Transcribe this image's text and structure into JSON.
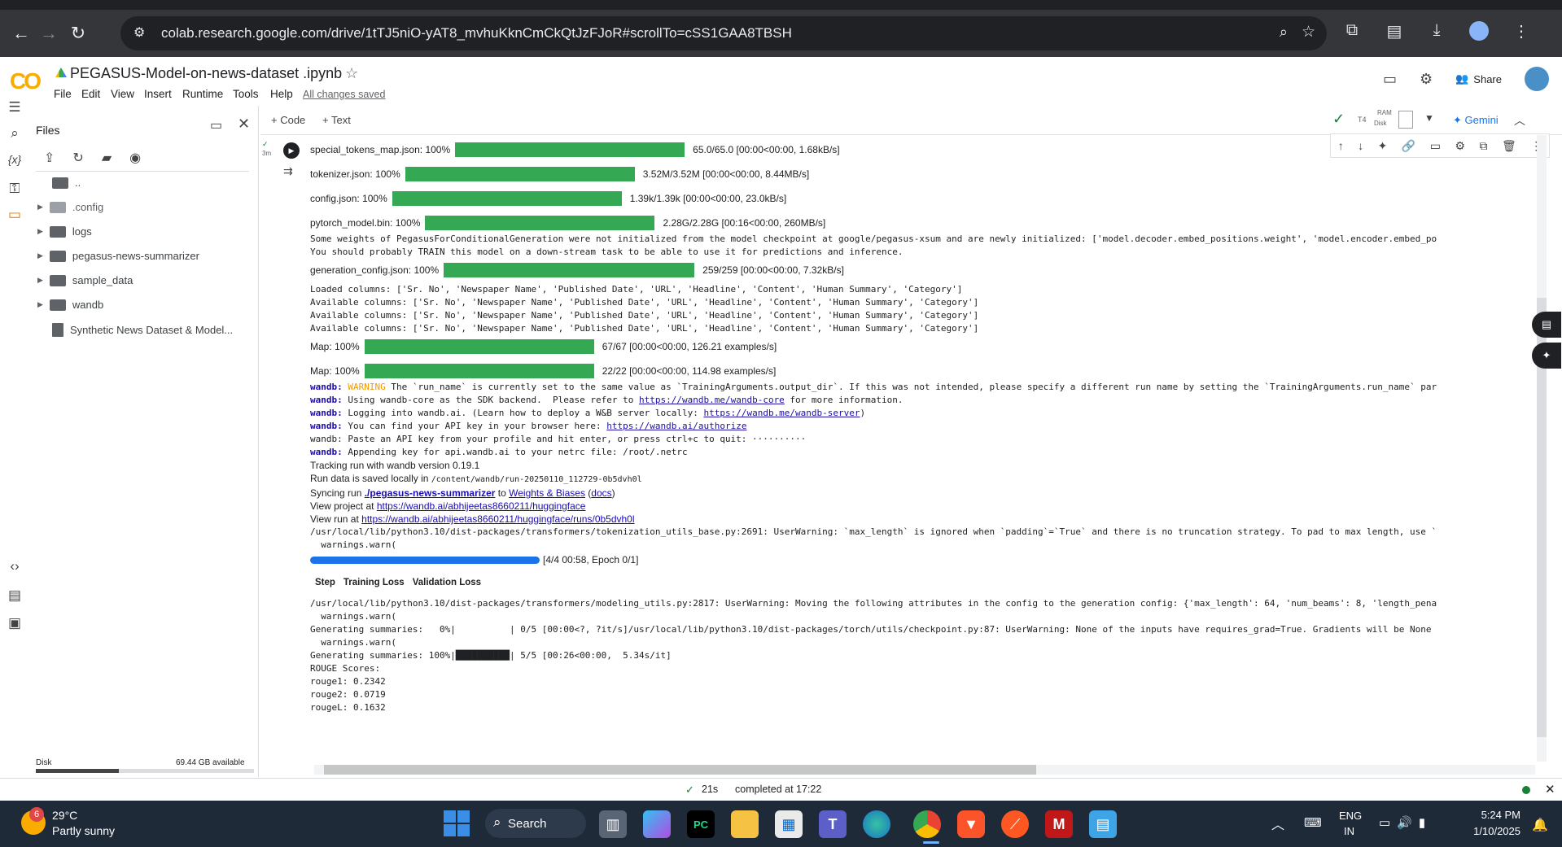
{
  "browser": {
    "url": "colab.research.google.com/drive/1tTJ5niO-yAT8_mvhuKknCmCkQtJzFJoR#scrollTo=cSS1GAA8TBSH"
  },
  "colab": {
    "logo": "CO",
    "notebook_title": "PEGASUS-Model-on-news-dataset .ipynb",
    "menu": [
      "File",
      "Edit",
      "View",
      "Insert",
      "Runtime",
      "Tools",
      "Help"
    ],
    "saved_status": "All changes saved",
    "share_label": "Share",
    "toolbar": {
      "code": "+ Code",
      "text": "+ Text",
      "runtime": "T4",
      "ram": "RAM",
      "disk": "Disk",
      "gemini": "Gemini"
    }
  },
  "files": {
    "title": "Files",
    "items": [
      {
        "name": "..",
        "expandable": false
      },
      {
        "name": ".config",
        "expandable": true
      },
      {
        "name": "logs",
        "expandable": true
      },
      {
        "name": "pegasus-news-summarizer",
        "expandable": true
      },
      {
        "name": "sample_data",
        "expandable": true
      },
      {
        "name": "wandb",
        "expandable": true
      },
      {
        "name": "Synthetic News Dataset & Model...",
        "expandable": false
      }
    ],
    "disk_label": "Disk",
    "disk_available": "69.44 GB available"
  },
  "cell": {
    "exec_time": "3m",
    "progress": [
      {
        "label": "special_tokens_map.json:",
        "pct": "100%",
        "stats": "65.0/65.0 [00:00<00:00, 1.68kB/s]"
      },
      {
        "label": "tokenizer.json:",
        "pct": "100%",
        "stats": "3.52M/3.52M [00:00<00:00, 8.44MB/s]"
      },
      {
        "label": "config.json:",
        "pct": "100%",
        "stats": "1.39k/1.39k [00:00<00:00, 23.0kB/s]"
      },
      {
        "label": "pytorch_model.bin:",
        "pct": "100%",
        "stats": "2.28G/2.28G [00:16<00:00, 260MB/s]"
      }
    ],
    "weights_msg1": "Some weights of PegasusForConditionalGeneration were not initialized from the model checkpoint at google/pegasus-xsum and are newly initialized: ['model.decoder.embed_positions.weight', 'model.encoder.embed_po",
    "weights_msg2": "You should probably TRAIN this model on a down-stream task to be able to use it for predictions and inference.",
    "gen_config": {
      "label": "generation_config.json:",
      "pct": "100%",
      "stats": "259/259 [00:00<00:00, 7.32kB/s]"
    },
    "columns": [
      "Loaded columns: ['Sr. No', 'Newspaper Name', 'Published Date', 'URL', 'Headline', 'Content', 'Human Summary', 'Category']",
      "Available columns: ['Sr. No', 'Newspaper Name', 'Published Date', 'URL', 'Headline', 'Content', 'Human Summary', 'Category']",
      "Available columns: ['Sr. No', 'Newspaper Name', 'Published Date', 'URL', 'Headline', 'Content', 'Human Summary', 'Category']",
      "Available columns: ['Sr. No', 'Newspaper Name', 'Published Date', 'URL', 'Headline', 'Content', 'Human Summary', 'Category']"
    ],
    "maps": [
      {
        "label": "Map:",
        "pct": "100%",
        "stats": "67/67 [00:00<00:00, 126.21 examples/s]"
      },
      {
        "label": "Map:",
        "pct": "100%",
        "stats": "22/22 [00:00<00:00, 114.98 examples/s]"
      }
    ],
    "wandb": {
      "prefix": "wandb:",
      "warning_tag": "WARNING",
      "warning_text": " The `run_name` is currently set to the same value as `TrainingArguments.output_dir`. If this was not intended, please specify a different run name by setting the `TrainingArguments.run_name` par",
      "core_pre": " Using wandb-core as the SDK backend.  Please refer to ",
      "core_link": "https://wandb.me/wandb-core",
      "core_post": " for more information.",
      "login_pre": " Logging into wandb.ai. (Learn how to deploy a W&B server locally: ",
      "login_link": "https://wandb.me/wandb-server",
      "login_post": ")",
      "api_pre": " You can find your API key in your browser here: ",
      "api_link": "https://wandb.ai/authorize",
      "paste": "wandb: Paste an API key from your profile and hit enter, or press ctrl+c to quit: ··········",
      "append": " Appending key for api.wandb.ai to your netrc file: /root/.netrc",
      "tracking": "Tracking run with wandb version 0.19.1",
      "run_saved_pre": "Run data is saved locally in ",
      "run_saved_path": "/content/wandb/run-20250110_112729-0b5dvh0l",
      "sync_pre": "Syncing run ",
      "sync_run": "./pegasus-news-summarizer",
      "sync_mid": " to ",
      "sync_wb": "Weights & Biases",
      "sync_docs_pre": " (",
      "sync_docs": "docs",
      "sync_docs_post": ")",
      "project_pre": "View project at ",
      "project_link": "https://wandb.ai/abhijeetas8660211/huggingface",
      "run_pre": "View run at ",
      "run_link": "https://wandb.ai/abhijeetas8660211/huggingface/runs/0b5dvh0l"
    },
    "tok_warning1": "/usr/local/lib/python3.10/dist-packages/transformers/tokenization_utils_base.py:2691: UserWarning: `max_length` is ignored when `padding`=`True` and there is no truncation strategy. To pad to max length, use `",
    "tok_warning2": "  warnings.warn(",
    "train_progress": {
      "fraction": 1.0,
      "text": "[4/4 00:58, Epoch 0/1]"
    },
    "table_headers": [
      "Step",
      "Training Loss",
      "Validation Loss"
    ],
    "tail_lines": [
      "/usr/local/lib/python3.10/dist-packages/transformers/modeling_utils.py:2817: UserWarning: Moving the following attributes in the config to the generation config: {'max_length': 64, 'num_beams': 8, 'length_pena",
      "  warnings.warn(",
      "Generating summaries:   0%|          | 0/5 [00:00<?, ?it/s]/usr/local/lib/python3.10/dist-packages/torch/utils/checkpoint.py:87: UserWarning: None of the inputs have requires_grad=True. Gradients will be None",
      "  warnings.warn(",
      "Generating summaries: 100%|██████████| 5/5 [00:26<00:00,  5.34s/it]",
      "ROUGE Scores:",
      "rouge1: 0.2342",
      "rouge2: 0.0719",
      "rougeL: 0.1632"
    ]
  },
  "status": {
    "check": "✓",
    "duration": "21s",
    "completed": "completed at 17:22"
  },
  "taskbar": {
    "weather_temp": "29°C",
    "weather_desc": "Partly sunny",
    "weather_badge": "6",
    "search": "Search",
    "lang": "ENG",
    "region": "IN",
    "time": "5:24 PM",
    "date": "1/10/2025"
  },
  "colors": {
    "accent": "#f9ab00",
    "bar": "#34a853",
    "link": "#1a0dab",
    "taskbar": "#1f2a38"
  }
}
